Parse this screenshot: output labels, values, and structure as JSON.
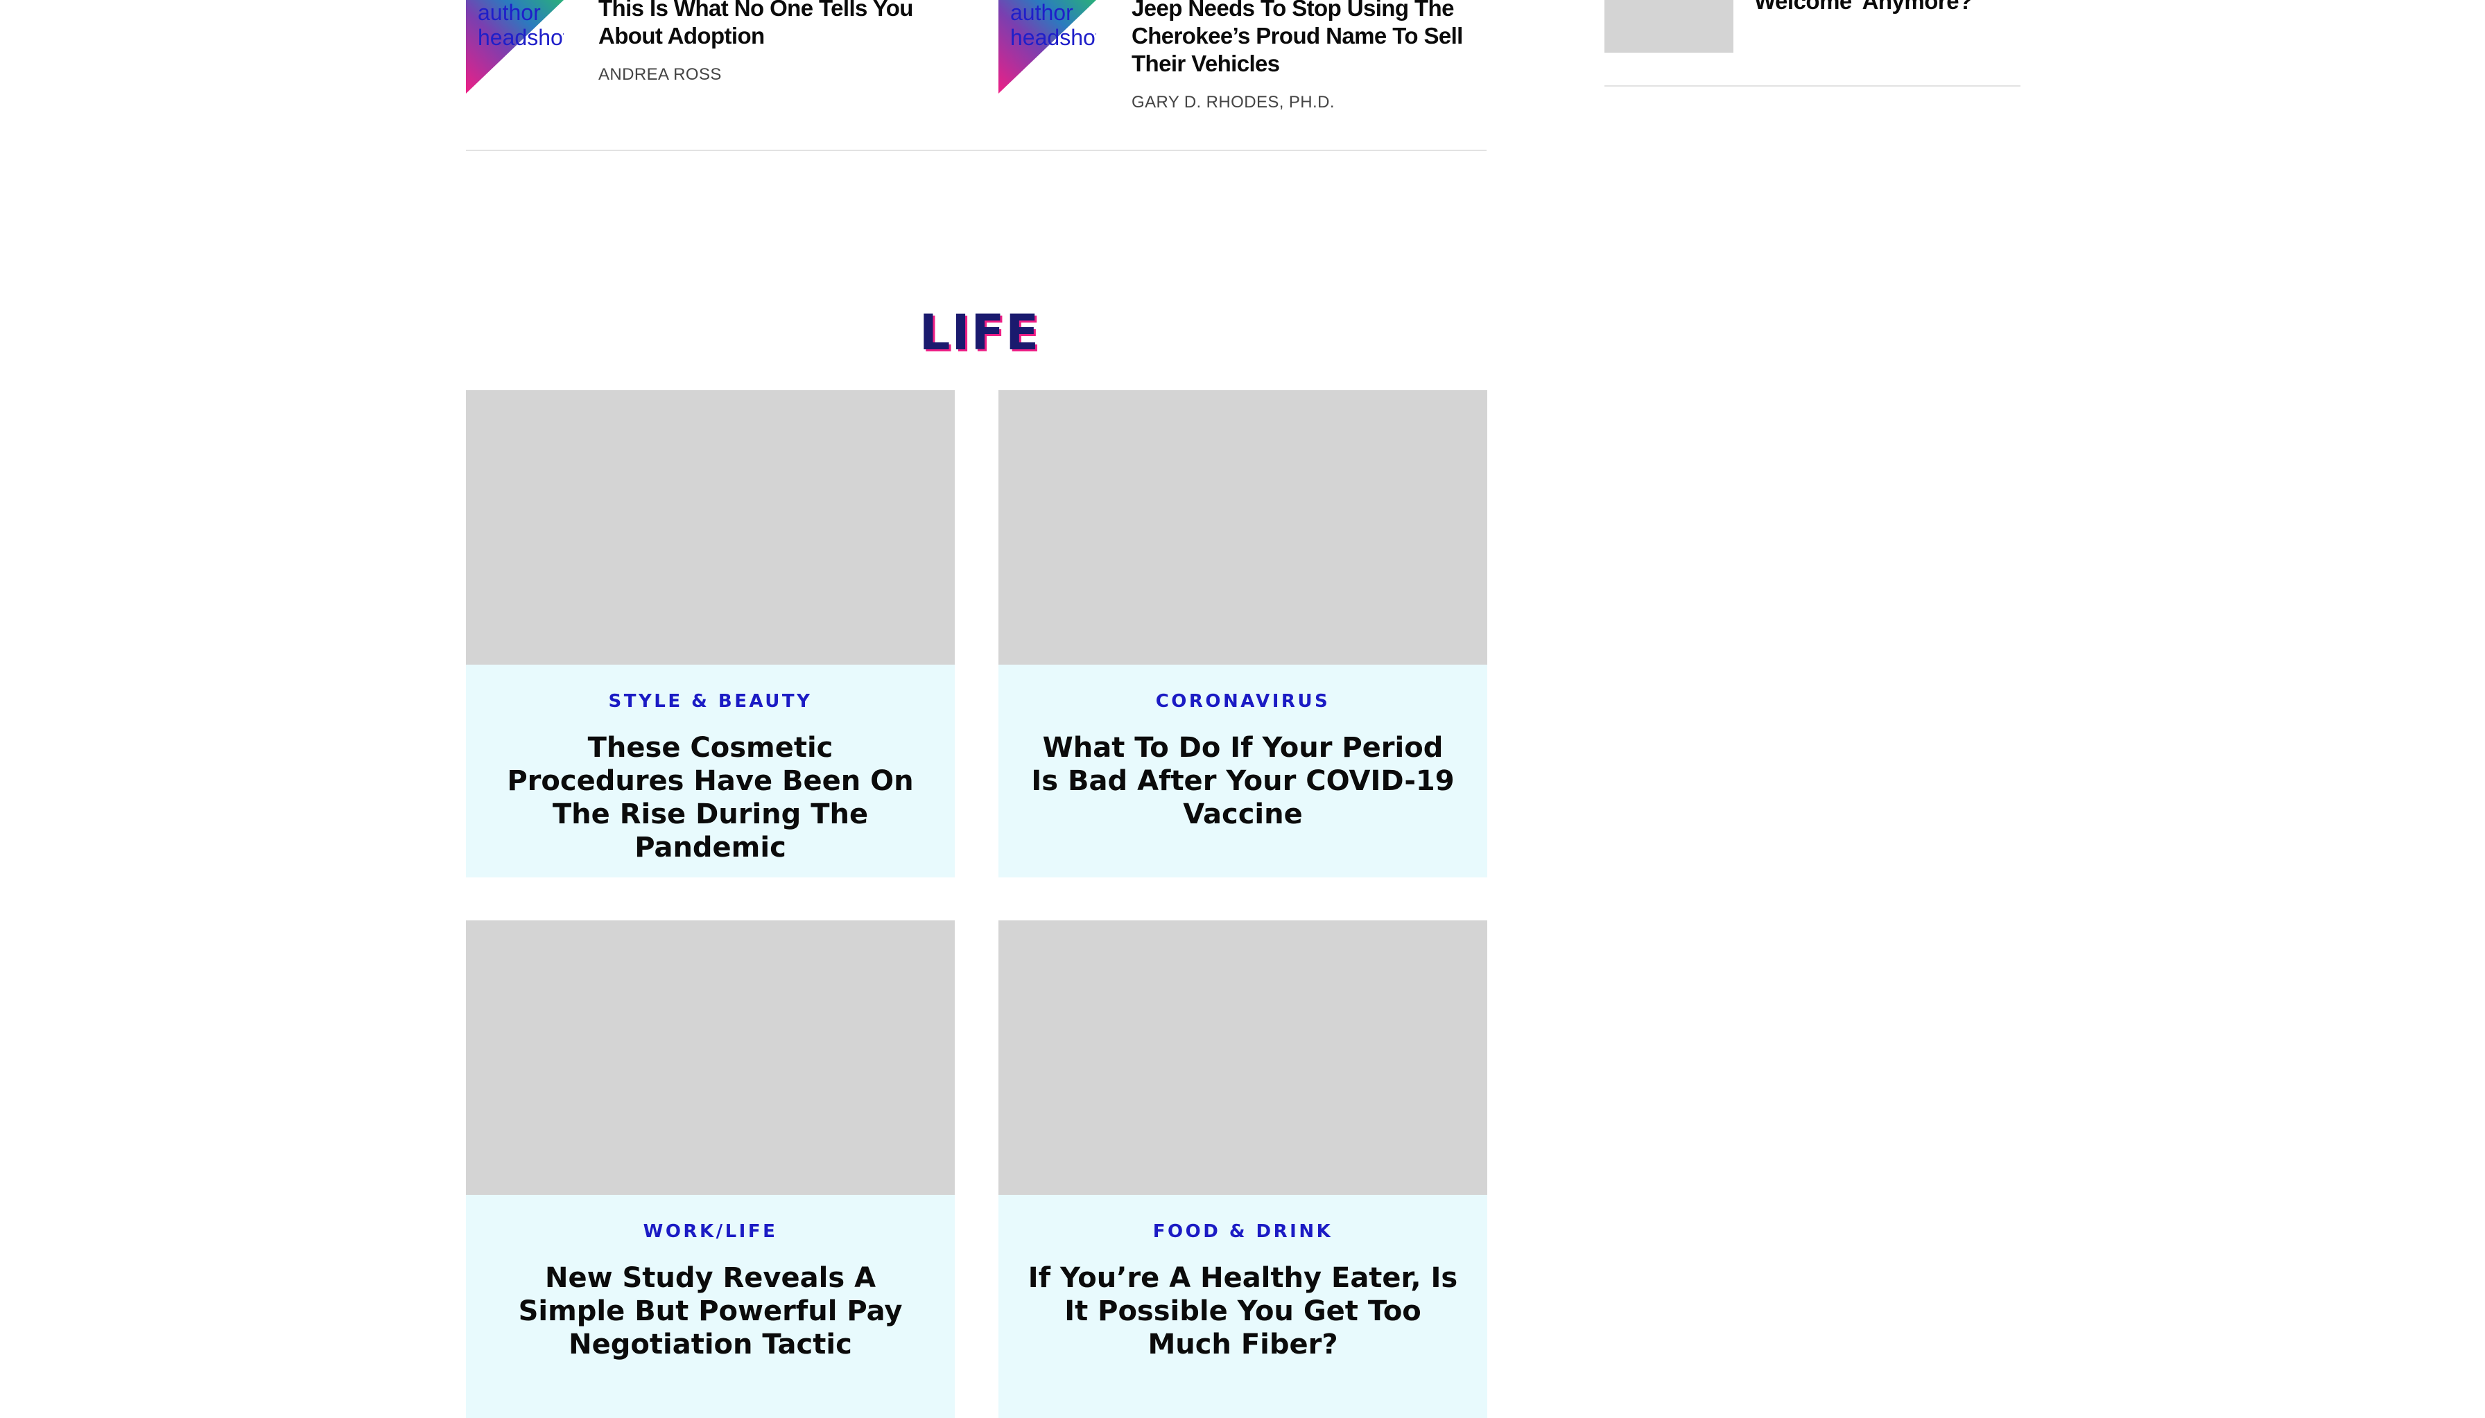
{
  "opinion_strip": [
    {
      "headshot_alt": "author headshot",
      "title": "This Is What No One Tells You About Adoption",
      "author": "ANDREA ROSS"
    },
    {
      "headshot_alt": "author headshot",
      "title": "Jeep Needs To Stop Using The Cherokee’s Proud Name To Sell Their Vehicles",
      "author": "GARY D. RHODES, PH.D."
    }
  ],
  "sidebar": {
    "partial_title": "Welcome' Anymore?"
  },
  "section": {
    "heading": "LIFE"
  },
  "cards": [
    {
      "kicker": "STYLE & BEAUTY",
      "headline": "These Cosmetic Procedures Have Been On The Rise During The Pandemic"
    },
    {
      "kicker": "CORONAVIRUS",
      "headline": "What To Do If Your Period Is Bad After Your COVID-19 Vaccine"
    },
    {
      "kicker": "WORK/LIFE",
      "headline": "New Study Reveals A Simple But Powerful Pay Negotiation Tactic"
    },
    {
      "kicker": "FOOD & DRINK",
      "headline": "If You’re A Healthy Eater, Is It Possible You Get Too Much Fiber?"
    }
  ],
  "colors": {
    "kicker_blue": "#1b1bc4",
    "card_bg": "#e8fafd",
    "image_placeholder": "#d4d4d4",
    "heading_navy": "#1a1a6e",
    "heading_shadow_pink": "#ee1f85"
  }
}
